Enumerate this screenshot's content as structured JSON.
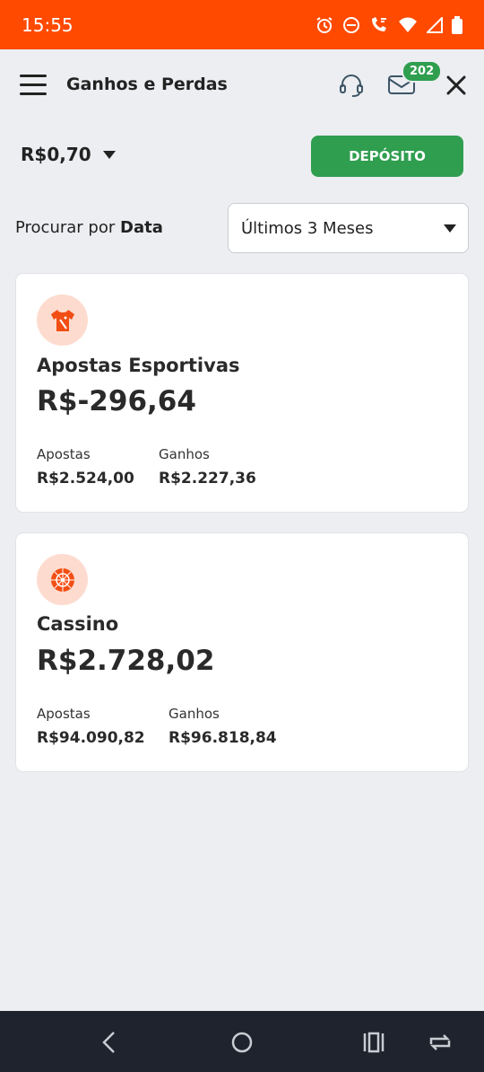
{
  "status_bar": {
    "time": "15:55"
  },
  "header": {
    "title": "Ganhos e Perdas",
    "mail_badge": "202"
  },
  "balance": {
    "amount": "R$0,70"
  },
  "deposit": {
    "label": "DEPÓSITO"
  },
  "search": {
    "label_prefix": "Procurar por",
    "label_strong": "Data",
    "selected_period": "Últimos 3 Meses"
  },
  "cards": [
    {
      "title": "Apostas Esportivas",
      "amount": "R$-296,64",
      "bets_label": "Apostas",
      "bets_value": "R$2.524,00",
      "wins_label": "Ganhos",
      "wins_value": "R$2.227,36"
    },
    {
      "title": "Cassino",
      "amount": "R$2.728,02",
      "bets_label": "Apostas",
      "bets_value": "R$94.090,82",
      "wins_label": "Ganhos",
      "wins_value": "R$96.818,84"
    }
  ],
  "colors": {
    "accent": "#ff4a00",
    "deposit": "#2f9e4f",
    "icon_bg": "#fddccf"
  }
}
